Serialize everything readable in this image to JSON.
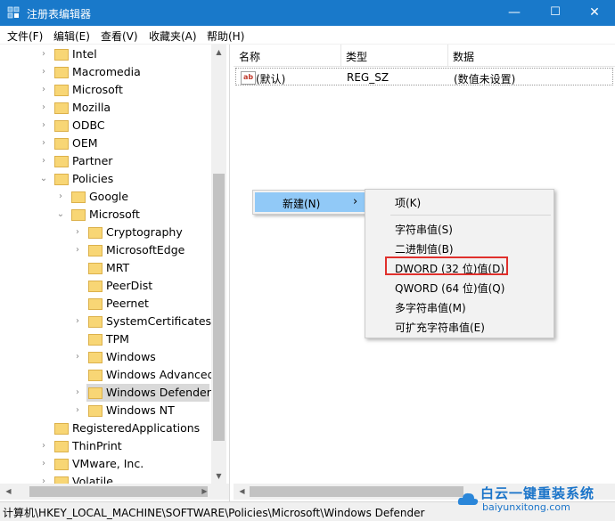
{
  "window": {
    "title": "注册表编辑器",
    "minimize": "—",
    "maximize": "☐",
    "close": "✕"
  },
  "menu": {
    "items": [
      "文件(F)",
      "编辑(E)",
      "查看(V)",
      "收藏夹(A)",
      "帮助(H)"
    ]
  },
  "tree": {
    "rows": [
      {
        "label": "Intel",
        "arrow": "›"
      },
      {
        "label": "Macromedia",
        "arrow": "›"
      },
      {
        "label": "Microsoft",
        "arrow": "›"
      },
      {
        "label": "Mozilla",
        "arrow": "›"
      },
      {
        "label": "ODBC",
        "arrow": "›"
      },
      {
        "label": "OEM",
        "arrow": "›"
      },
      {
        "label": "Partner",
        "arrow": "›"
      },
      {
        "label": "Policies",
        "arrow": "⌄"
      },
      {
        "label": "Google",
        "arrow": "›"
      },
      {
        "label": "Microsoft",
        "arrow": "⌄"
      },
      {
        "label": "Cryptography",
        "arrow": "›"
      },
      {
        "label": "MicrosoftEdge",
        "arrow": "›"
      },
      {
        "label": "MRT",
        "arrow": ""
      },
      {
        "label": "PeerDist",
        "arrow": ""
      },
      {
        "label": "Peernet",
        "arrow": ""
      },
      {
        "label": "SystemCertificates",
        "arrow": "›"
      },
      {
        "label": "TPM",
        "arrow": ""
      },
      {
        "label": "Windows",
        "arrow": "›"
      },
      {
        "label": "Windows Advanced",
        "arrow": ""
      },
      {
        "label": "Windows Defender",
        "arrow": "›"
      },
      {
        "label": "Windows NT",
        "arrow": "›"
      },
      {
        "label": "RegisteredApplications",
        "arrow": ""
      },
      {
        "label": "ThinPrint",
        "arrow": "›"
      },
      {
        "label": "VMware, Inc.",
        "arrow": "›"
      },
      {
        "label": "Volatile",
        "arrow": "›"
      }
    ],
    "selected": "Windows Defender"
  },
  "list": {
    "headers": {
      "name": "名称",
      "type": "类型",
      "data": "数据"
    },
    "rows": [
      {
        "name": "(默认)",
        "type": "REG_SZ",
        "data": "(数值未设置)",
        "icon": "ab-string-icon"
      }
    ]
  },
  "context_menu": {
    "new_label": "新建(N)",
    "arrow": "›"
  },
  "submenu": {
    "items": [
      "项(K)",
      "字符串值(S)",
      "二进制值(B)",
      "DWORD (32 位)值(D)",
      "QWORD (64 位)值(Q)",
      "多字符串值(M)",
      "可扩充字符串值(E)"
    ],
    "highlighted": "DWORD (32 位)值(D)"
  },
  "status": {
    "path": "计算机\\HKEY_LOCAL_MACHINE\\SOFTWARE\\Policies\\Microsoft\\Windows Defender"
  },
  "watermark": {
    "line1": "白云一键重装系统",
    "line2": "baiyunxitong.com"
  },
  "colors": {
    "titlebar": "#1979ca",
    "menu_hover": "#91c9f7",
    "highlight_border": "#e0302c"
  }
}
